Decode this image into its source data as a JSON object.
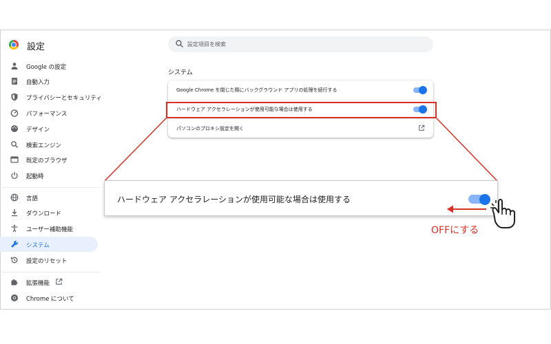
{
  "header": {
    "app_title": "設定",
    "search_placeholder": "設定項目を検索"
  },
  "sidebar": {
    "items": [
      {
        "label": "Google の設定",
        "icon": "person-icon"
      },
      {
        "label": "自動入力",
        "icon": "clipboard-icon"
      },
      {
        "label": "プライバシーとセキュリティ",
        "icon": "shield-icon"
      },
      {
        "label": "パフォーマンス",
        "icon": "speedometer-icon"
      },
      {
        "label": "デザイン",
        "icon": "palette-icon"
      },
      {
        "label": "検索エンジン",
        "icon": "search-icon"
      },
      {
        "label": "既定のブラウザ",
        "icon": "browser-icon"
      },
      {
        "label": "起動時",
        "icon": "power-icon"
      },
      {
        "label": "言語",
        "icon": "globe-icon"
      },
      {
        "label": "ダウンロード",
        "icon": "download-icon"
      },
      {
        "label": "ユーザー補助機能",
        "icon": "accessibility-icon"
      },
      {
        "label": "システム",
        "icon": "wrench-icon",
        "active": true
      },
      {
        "label": "設定のリセット",
        "icon": "reset-icon"
      },
      {
        "label": "拡張機能",
        "icon": "puzzle-icon"
      },
      {
        "label": "Chrome について",
        "icon": "chrome-icon"
      }
    ]
  },
  "main": {
    "section_title": "システム",
    "rows": [
      {
        "label": "Google Chrome を閉じた際にバックグラウンド アプリの処理を続行する",
        "toggle_on": true
      },
      {
        "label": "ハードウェア アクセラレーションが使用可能な場合は使用する",
        "toggle_on": true
      },
      {
        "label": "パソコンのプロキシ設定を開く",
        "icon": "external-link-icon"
      }
    ]
  },
  "callout": {
    "zoom_label": "ハードウェア アクセラレーションが使用可能な場合は使用する",
    "zoom_toggle_on": true,
    "annotation": "OFFにする"
  },
  "colors": {
    "accent": "#1a73e8",
    "toggle_track": "#8ab4f8",
    "highlight": "#d93025",
    "active_bg": "#e8f0fe"
  }
}
